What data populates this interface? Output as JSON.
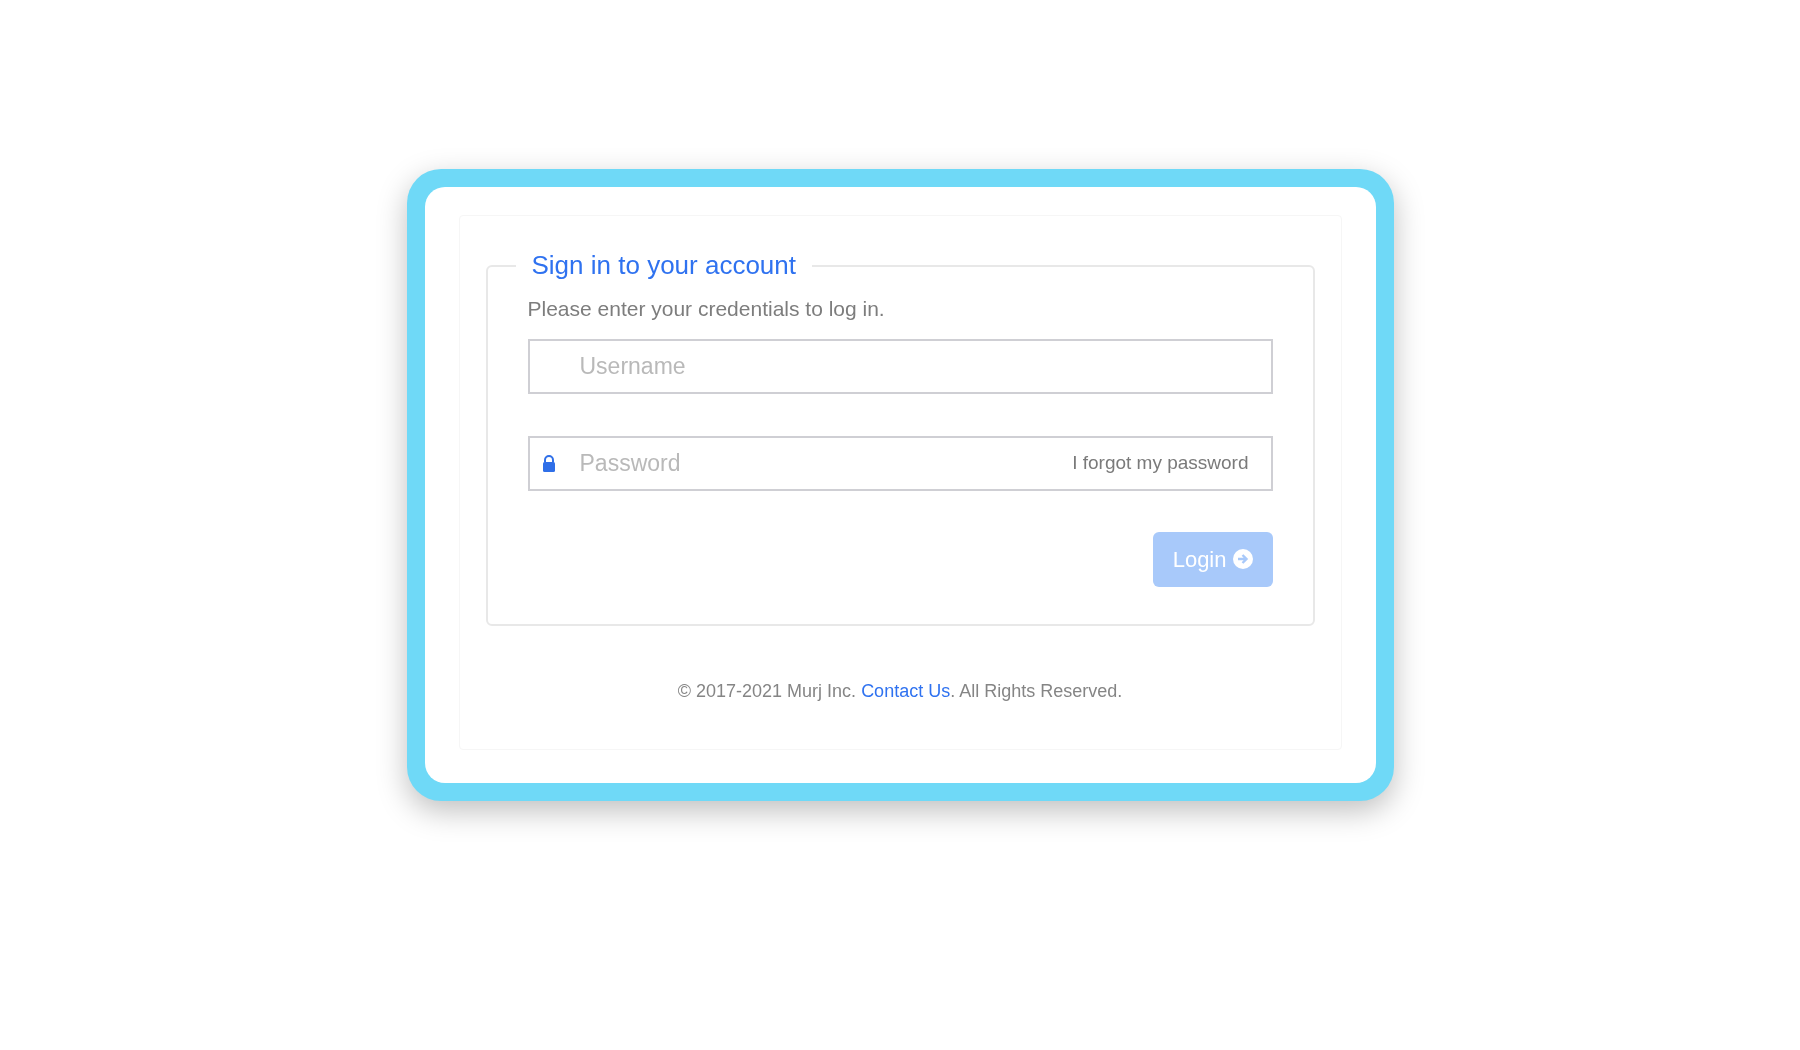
{
  "login_form": {
    "title": "Sign in to your account",
    "instructions": "Please enter your credentials to log in.",
    "username": {
      "placeholder": "Username"
    },
    "password": {
      "placeholder": "Password",
      "forgot_link": "I forgot my password"
    },
    "login_button": {
      "label": "Login",
      "disabled": true
    }
  },
  "footer": {
    "copyright": "© 2017-2021 Murj Inc.",
    "link": "Contact Us",
    "rest": ". All Rights Reserved."
  }
}
